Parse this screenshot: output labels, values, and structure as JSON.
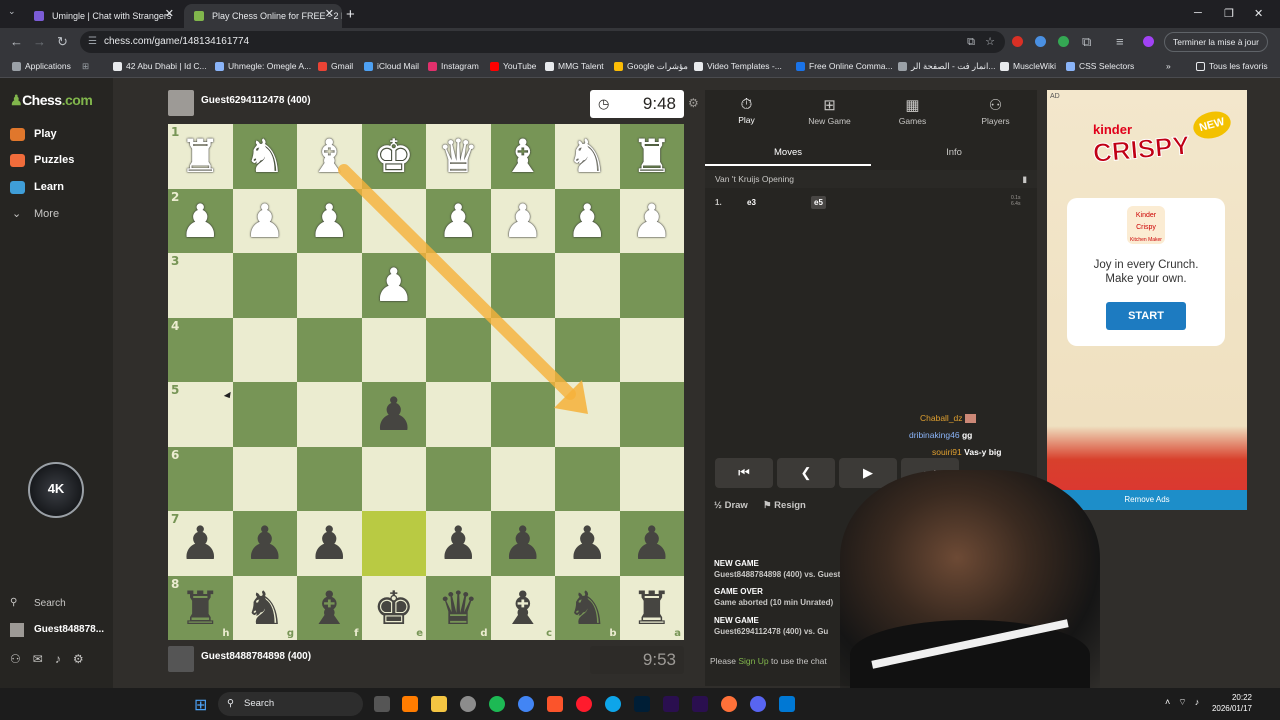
{
  "browser": {
    "tabs": [
      {
        "title": "Umingle | Chat with Strangers",
        "favicon_color": "#7b5cd6",
        "active": false
      },
      {
        "title": "Play Chess Online for FREE - 2 P",
        "favicon_color": "#81b64c",
        "active": true
      }
    ],
    "url": "chess.com/game/148134161774",
    "update_label": "Terminer la mise à jour",
    "bookmarks": [
      {
        "label": "Applications",
        "color": "#9aa0a6"
      },
      {
        "label": "42 Abu Dhabi | Id C...",
        "color": "#e8eaed"
      },
      {
        "label": "Uhmegle: Omegle A...",
        "color": "#8ab4f8"
      },
      {
        "label": "Gmail",
        "color": "#ea4335"
      },
      {
        "label": "iCloud Mail",
        "color": "#4ea1f3"
      },
      {
        "label": "Instagram",
        "color": "#e1306c"
      },
      {
        "label": "YouTube",
        "color": "#ff0000"
      },
      {
        "label": "MMG Talent",
        "color": "#e8eaed"
      },
      {
        "label": "Google مؤشرات",
        "color": "#fbbc05"
      },
      {
        "label": "Video Templates -...",
        "color": "#e8eaed"
      },
      {
        "label": "Free Online Comma...",
        "color": "#1a73e8"
      },
      {
        "label": "انمار فت - الصفحة الر...",
        "color": "#9aa0a6"
      },
      {
        "label": "MuscleWiki",
        "color": "#e8eaed"
      },
      {
        "label": "CSS Selectors",
        "color": "#8ab4f8"
      }
    ],
    "all_bookmarks_label": "Tous les favoris"
  },
  "sidebar": {
    "logo_prefix": "Chess",
    "logo_suffix": ".com",
    "items": [
      {
        "label": "Play",
        "color": "#e0772c"
      },
      {
        "label": "Puzzles",
        "color": "#f06c3b"
      },
      {
        "label": "Learn",
        "color": "#3f9ed8"
      },
      {
        "label": "More",
        "color": "#c8c7c5"
      }
    ],
    "avatar_text": "4K",
    "search_label": "Search",
    "user_label": "Guest848878..."
  },
  "game": {
    "top_player": {
      "name": "Guest6294112478 (400)",
      "clock": "9:48"
    },
    "bottom_player": {
      "name": "Guest8488784898 (400)",
      "clock": "9:53"
    },
    "ranks": [
      "1",
      "2",
      "3",
      "4",
      "5",
      "6",
      "7",
      "8"
    ],
    "files": [
      "h",
      "g",
      "f",
      "e",
      "d",
      "c",
      "b",
      "a"
    ],
    "board": [
      [
        "wr",
        "wn",
        "wb",
        "wk",
        "wq",
        "wb",
        "wn",
        "wr"
      ],
      [
        "wp",
        "wp",
        "wp",
        "",
        "wp",
        "wp",
        "wp",
        "wp"
      ],
      [
        "",
        "",
        "",
        "wp",
        "",
        "",
        "",
        ""
      ],
      [
        "",
        "",
        "",
        "",
        "",
        "",
        "",
        ""
      ],
      [
        "",
        "",
        "",
        "bp",
        "",
        "",
        "",
        ""
      ],
      [
        "",
        "",
        "",
        "",
        "",
        "",
        "",
        ""
      ],
      [
        "bp",
        "bp",
        "bp",
        "",
        "bp",
        "bp",
        "bp",
        "bp"
      ],
      [
        "br",
        "bn",
        "bb",
        "bk",
        "bq",
        "bb",
        "bn",
        "br"
      ]
    ],
    "highlight_square": [
      6,
      3
    ],
    "arrow": {
      "from": "f1",
      "to": "b5",
      "color": "#f6b23a"
    }
  },
  "panel": {
    "tabs": [
      {
        "label": "Play",
        "icon": "clock-icon"
      },
      {
        "label": "New Game",
        "icon": "plus-icon"
      },
      {
        "label": "Games",
        "icon": "games-icon"
      },
      {
        "label": "Players",
        "icon": "players-icon"
      }
    ],
    "subtabs": [
      "Moves",
      "Info"
    ],
    "opening": "Van 't Kruijs Opening",
    "move_number": "1.",
    "white_move": "e3",
    "black_move": "e5",
    "move_time_1": "0.1s",
    "move_time_2": "6.4s",
    "chat": [
      {
        "user": "Chaball_dz",
        "text": "",
        "color": "#e0a030"
      },
      {
        "user": "dribinaking46",
        "text": "gg",
        "color": "#8ab4f8"
      },
      {
        "user": "souiri91",
        "text": "Vas-y big",
        "color": "#e0a030"
      }
    ],
    "draw_label": "Draw",
    "resign_label": "Resign",
    "log": [
      {
        "heading": "NEW GAME",
        "text": "Guest8488784898 (400) vs. Guest01351514"
      },
      {
        "heading": "GAME OVER",
        "text": "Game aborted (10 min Unrated)"
      },
      {
        "heading": "NEW GAME",
        "text": "Guest6294112478 (400) vs. Gu"
      }
    ],
    "chat_prompt_prefix": "Please",
    "chat_prompt_link": "Sign Up",
    "chat_prompt_suffix": "to use the chat"
  },
  "ad": {
    "label": "AD",
    "brand": "kinder",
    "product": "CRISPY",
    "badge": "NEW",
    "mini_line1": "Kinder",
    "mini_line2": "Crispy",
    "mini_line3": "Kitchen Maker",
    "tagline_1": "Joy in every Crunch.",
    "tagline_2": "Make your own.",
    "cta": "START",
    "remove": "Remove Ads"
  },
  "taskbar": {
    "search_label": "Search",
    "time": "20:22",
    "date": "2026/01/17"
  }
}
